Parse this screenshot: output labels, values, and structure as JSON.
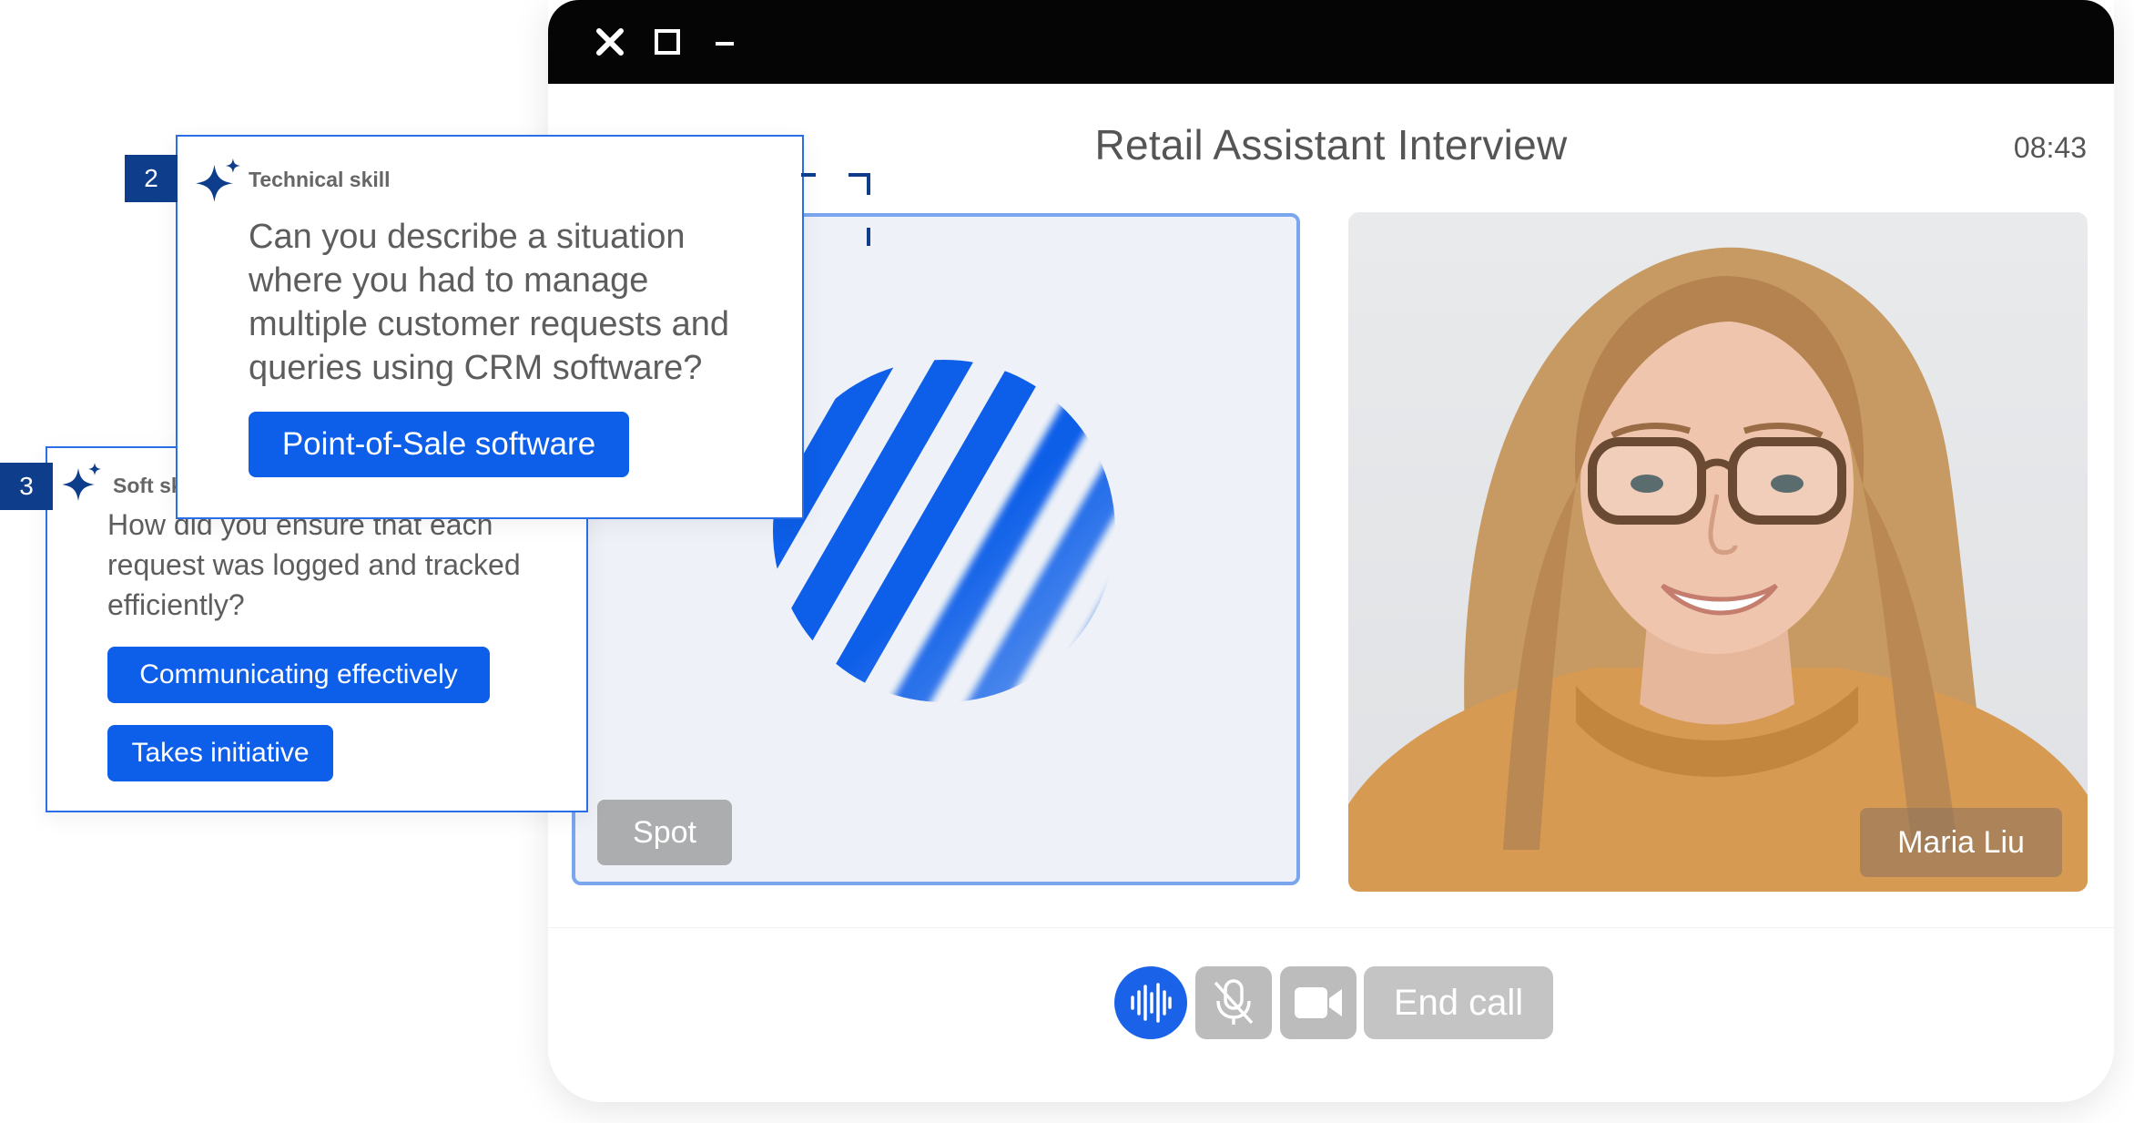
{
  "window": {
    "controls": {
      "close_icon": "close-icon",
      "maximize_icon": "maximize-icon",
      "minimize_icon": "minimize-icon"
    },
    "title": "Retail Assistant Interview",
    "timer": "08:43"
  },
  "ai_tile": {
    "label": "Spot"
  },
  "candidate_tile": {
    "name": "Maria Liu"
  },
  "controls": {
    "audio_icon": "audio-wave-icon",
    "mic_icon": "mic-off-icon",
    "camera_icon": "video-camera-icon",
    "end_call_label": "End call"
  },
  "cards": [
    {
      "number": "2",
      "tag": "Technical skill",
      "question": "Can you describe a situation where you had to manage multiple customer requests and queries using CRM software?",
      "chips": [
        "Point-of-Sale software"
      ]
    },
    {
      "number": "3",
      "tag": "Soft ski",
      "question": "How did you ensure that each request was logged and tracked efficiently?",
      "chips": [
        "Communicating effectively",
        "Takes initiative"
      ]
    }
  ],
  "colors": {
    "accent": "#0d5ee8",
    "navy": "#0e3d8c",
    "titlebar": "#050505",
    "button_gray": "#bcbcbc"
  }
}
